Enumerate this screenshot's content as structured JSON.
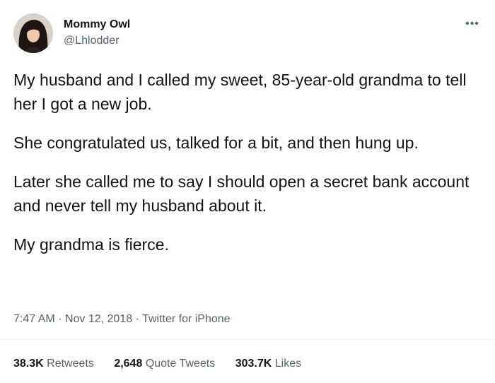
{
  "author": {
    "name": "Mommy Owl",
    "handle": "@Lhlodder"
  },
  "tweet": {
    "paragraphs": [
      "My husband and I called my sweet, 85-year-old grandma to tell her I got a new job.",
      "She congratulated us, talked for a bit, and then hung up.",
      "Later she called me to say I should open a secret bank account and never tell my husband about it.",
      "My grandma is fierce."
    ],
    "time": "7:47 AM",
    "date": "Nov 12, 2018",
    "source": "Twitter for iPhone",
    "separator": "·"
  },
  "stats": {
    "retweets_count": "38.3K",
    "retweets_label": "Retweets",
    "quotes_count": "2,648",
    "quotes_label": "Quote Tweets",
    "likes_count": "303.7K",
    "likes_label": "Likes"
  },
  "icons": {
    "more": "more-icon"
  },
  "colors": {
    "text_primary": "#0f1419",
    "text_secondary": "#536471",
    "divider": "#eff3f4"
  }
}
